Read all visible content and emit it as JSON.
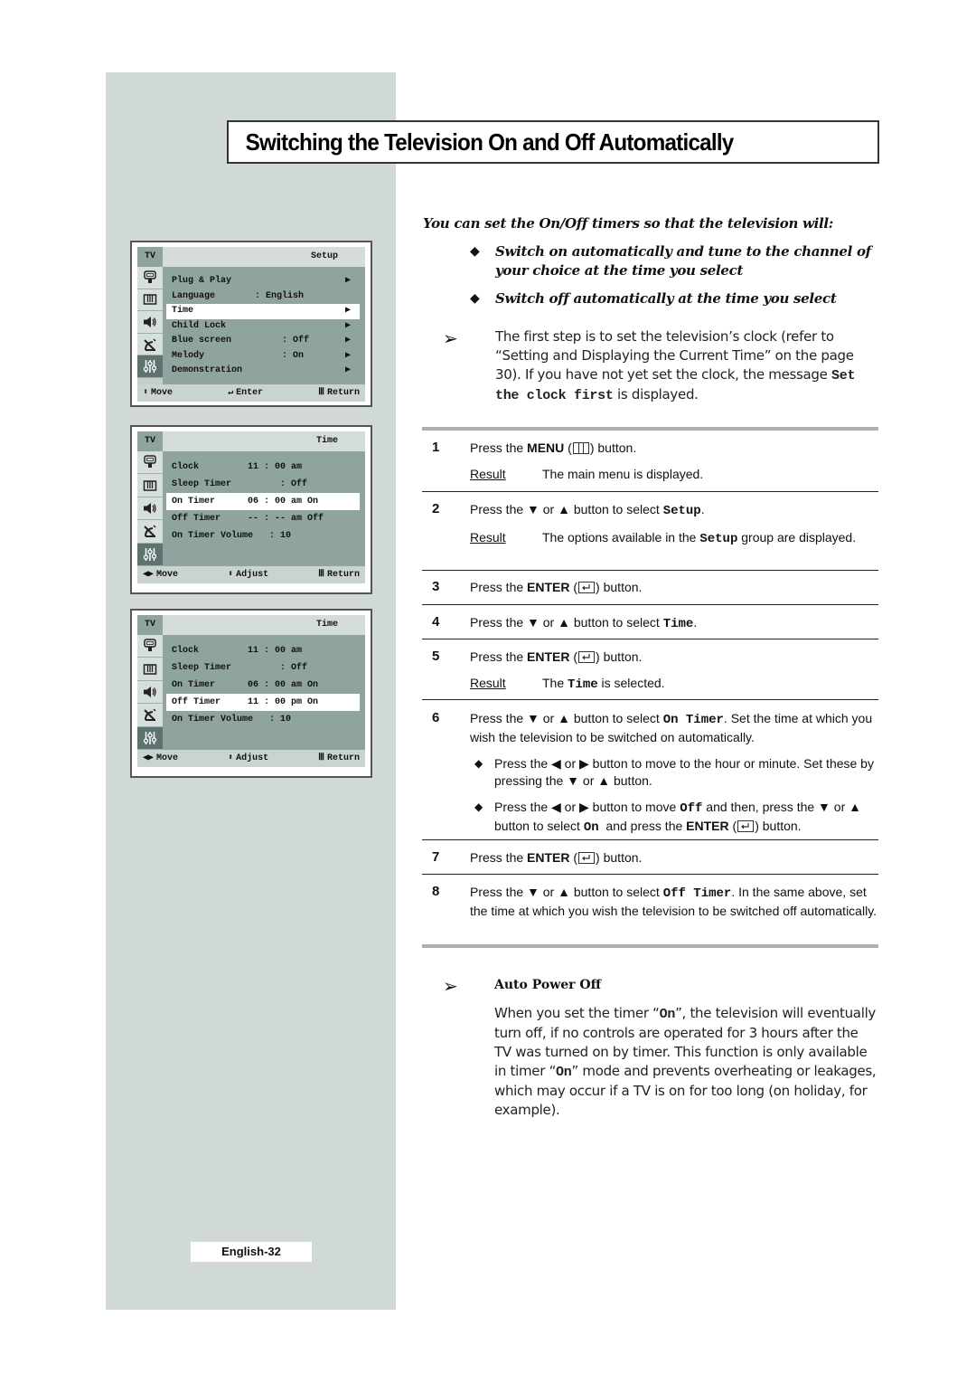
{
  "title": "Switching the Television On and Off Automatically",
  "page_number": "English-32",
  "osd_menus": [
    {
      "tv_label": "TV",
      "heading": "Setup",
      "rows": [
        {
          "label": "Plug & Play",
          "value": "",
          "arrow": "▶",
          "selected": false
        },
        {
          "label": "Language",
          "value": ": English",
          "arrow": "",
          "selected": false
        },
        {
          "label": "Time",
          "value": "",
          "arrow": "▶",
          "selected": true
        },
        {
          "label": "Child Lock",
          "value": "",
          "arrow": "▶",
          "selected": false
        },
        {
          "label": "Blue screen",
          "value": "     : Off",
          "arrow": "▶",
          "selected": false
        },
        {
          "label": "Melody",
          "value": "     : On",
          "arrow": "▶",
          "selected": false
        },
        {
          "label": "Demonstration",
          "value": "",
          "arrow": "▶",
          "selected": false
        }
      ],
      "footer": [
        {
          "icon": "updown-icon",
          "glyph": "⬍",
          "label": "Move"
        },
        {
          "icon": "enter-icon",
          "glyph": "↵",
          "label": "Enter"
        },
        {
          "icon": "menu-icon",
          "glyph": "Ⅲ",
          "label": "Return"
        }
      ]
    },
    {
      "tv_label": "TV",
      "heading": "Time",
      "rows": [
        {
          "label": "Clock",
          "value": "11 : 00 am",
          "selected": false
        },
        {
          "label": "Sleep Timer",
          "value": "      : Off",
          "selected": false
        },
        {
          "label": "On Timer",
          "value": "06 : 00 am On",
          "selected": true
        },
        {
          "label": "Off Timer",
          "value": "-- : -- am Off",
          "selected": false
        },
        {
          "label": "On Timer Volume",
          "value": "    : 10",
          "selected": false
        }
      ],
      "footer": [
        {
          "icon": "leftright-icon",
          "glyph": "◀▶",
          "label": "Move"
        },
        {
          "icon": "updown-icon",
          "glyph": "⬍",
          "label": "Adjust"
        },
        {
          "icon": "menu-icon",
          "glyph": "Ⅲ",
          "label": "Return"
        }
      ]
    },
    {
      "tv_label": "TV",
      "heading": "Time",
      "rows": [
        {
          "label": "Clock",
          "value": "11 : 00 am",
          "selected": false
        },
        {
          "label": "Sleep Timer",
          "value": "      : Off",
          "selected": false
        },
        {
          "label": "On Timer",
          "value": "06 : 00 am On",
          "selected": false
        },
        {
          "label": "Off Timer",
          "value": "11 : 00 pm On",
          "selected": true
        },
        {
          "label": "On Timer Volume",
          "value": "    : 10",
          "selected": false
        }
      ],
      "footer": [
        {
          "icon": "leftright-icon",
          "glyph": "◀▶",
          "label": "Move"
        },
        {
          "icon": "updown-icon",
          "glyph": "⬍",
          "label": "Adjust"
        },
        {
          "icon": "menu-icon",
          "glyph": "Ⅲ",
          "label": "Return"
        }
      ]
    }
  ],
  "osd_icons": [
    "plug-icon",
    "picture-icon",
    "sound-icon",
    "channel-icon",
    "setup-icon"
  ],
  "intro": {
    "lead": "You can set the On/Off timers so that the television will:",
    "bullets": [
      "Switch on automatically and tune to the channel of your choice at the time you select",
      "Switch off automatically at the time you select"
    ]
  },
  "note": {
    "text_before": "The first step is to set the television’s clock (refer to “Setting and Displaying the Current Time” on the page 30). If you have not yet set the clock, the message ",
    "code": "Set the clock first",
    "text_after": " is displayed."
  },
  "steps": [
    {
      "num": "1",
      "pre": "Press the ",
      "bold": "MENU",
      "post": " button.",
      "key": "menu",
      "result": "The main menu is displayed."
    },
    {
      "num": "2",
      "pre": "Press the ▼ or ▲ button to select ",
      "code": "Setup",
      "post": ".",
      "result_pre": "The options available in the ",
      "result_code": "Setup",
      "result_post": " group are displayed."
    },
    {
      "num": "3",
      "pre": "Press the ",
      "bold": "ENTER",
      "post": " button.",
      "key": "enter"
    },
    {
      "num": "4",
      "pre": "Press the ▼ or ▲ button to select ",
      "code": "Time",
      "post": "."
    },
    {
      "num": "5",
      "pre": "Press the ",
      "bold": "ENTER",
      "post": " button.",
      "key": "enter",
      "result_pre": "The ",
      "result_code": "Time",
      "result_post": " is selected."
    },
    {
      "num": "6",
      "pre": "Press the ▼ or ▲ button to select ",
      "code": "On Timer",
      "post": ". Set the time at which you wish the television to be switched on automatically.",
      "subs": [
        {
          "text": "Press the ◀ or ▶ button to move to the hour or minute. Set these by pressing the ▼ or ▲ button."
        },
        {
          "pre": "Press the ◀ or ▶ button to move ",
          "code1": "Off",
          "mid": " and then, press the ▼ or ▲ button to select ",
          "code2": "On",
          "mid2": "  and press the ",
          "bold": "ENTER",
          "post": " button."
        }
      ]
    },
    {
      "num": "7",
      "pre": "Press the ",
      "bold": "ENTER",
      "post": " button.",
      "key": "enter"
    },
    {
      "num": "8",
      "pre": "Press the ▼ or ▲ button to select ",
      "code": "Off Timer",
      "post": ". In the same above, set the time at which you wish the television to be switched off automatically."
    }
  ],
  "result_label": "Result",
  "auto_power_off": {
    "heading": "Auto Power Off",
    "p1": "When you set the timer “",
    "code1": "On",
    "p2": "”, the television will eventually turn off, if no controls are operated for 3 hours after the TV was turned on by timer. This function is only available in timer “",
    "code2": "On",
    "p3": "” mode and prevents overheating or leakages, which may occur if a TV is on for too long (on holiday, for example)."
  }
}
